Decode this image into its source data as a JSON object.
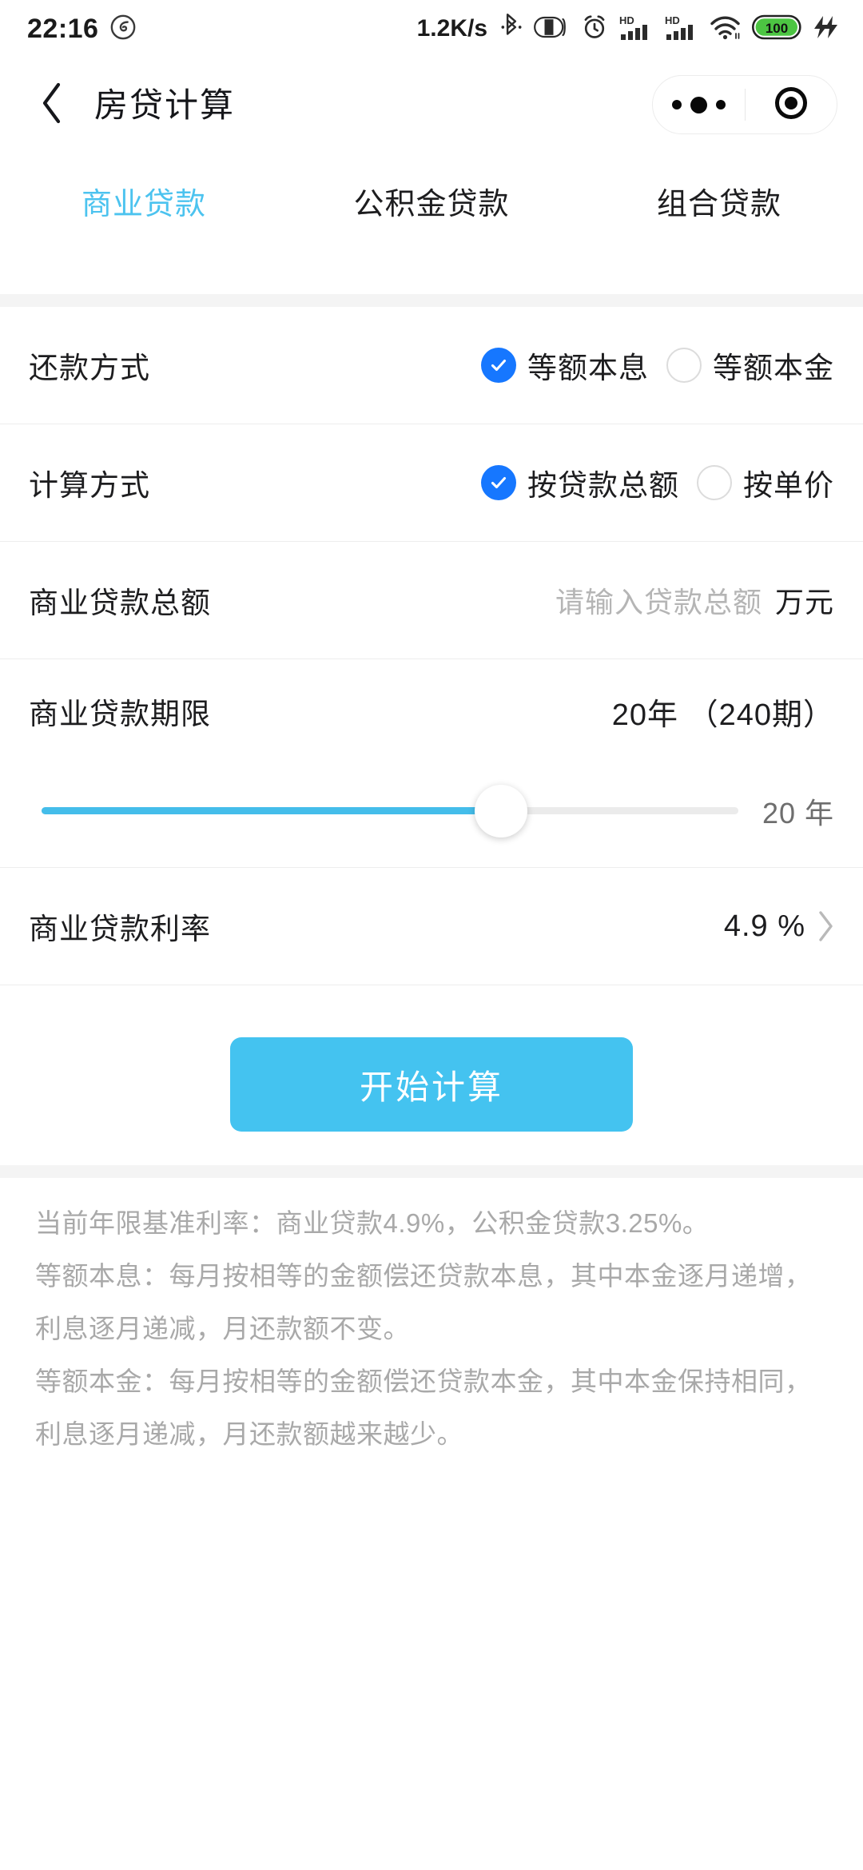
{
  "status_bar": {
    "time": "22:16",
    "network_speed": "1.2K/s",
    "battery_level": "100",
    "icons": [
      "music-note-icon",
      "bluetooth-icon",
      "dark-mode-icon",
      "alarm-clock-icon",
      "hd-signal-icon-1",
      "hd-signal-icon-2",
      "wifi-icon",
      "battery-icon",
      "charging-bolt-icon"
    ]
  },
  "nav": {
    "title": "房贷计算",
    "back_icon": "chevron-left-icon",
    "capsule": {
      "more_icon": "more-dots-icon",
      "target_icon": "target-circle-icon"
    }
  },
  "tabs": [
    {
      "label": "商业贷款",
      "active": true
    },
    {
      "label": "公积金贷款",
      "active": false
    },
    {
      "label": "组合贷款",
      "active": false
    }
  ],
  "form": {
    "repayment_method": {
      "label": "还款方式",
      "options": [
        {
          "label": "等额本息",
          "selected": true
        },
        {
          "label": "等额本金",
          "selected": false
        }
      ]
    },
    "calc_method": {
      "label": "计算方式",
      "options": [
        {
          "label": "按贷款总额",
          "selected": true
        },
        {
          "label": "按单价",
          "selected": false
        }
      ]
    },
    "loan_total": {
      "label": "商业贷款总额",
      "value": "",
      "placeholder": "请输入贷款总额",
      "unit": "万元"
    },
    "loan_term": {
      "label": "商业贷款期限",
      "value": "20年 （240期）",
      "slider_value": "20 年",
      "slider_years": 20,
      "slider_min": 1,
      "slider_max": 30,
      "slider_percent": 66
    },
    "loan_rate": {
      "label": "商业贷款利率",
      "value": "4.9 %",
      "chevron_icon": "chevron-right-icon"
    },
    "submit_label": "开始计算"
  },
  "notes": [
    "当前年限基准利率：商业贷款4.9%，公积金贷款3.25%。",
    "等额本息：每月按相等的金额偿还贷款本息，其中本金逐月递增，利息逐月递减，月还款额不变。",
    "等额本金：每月按相等的金额偿还贷款本金，其中本金保持相同，利息逐月递减，月还款额越来越少。"
  ],
  "colors": {
    "accent_cyan": "#44c3f0",
    "radio_blue": "#1677ff",
    "band_gray": "#f4f4f4",
    "note_gray": "#a9a9a9",
    "battery_green": "#4cc542"
  }
}
